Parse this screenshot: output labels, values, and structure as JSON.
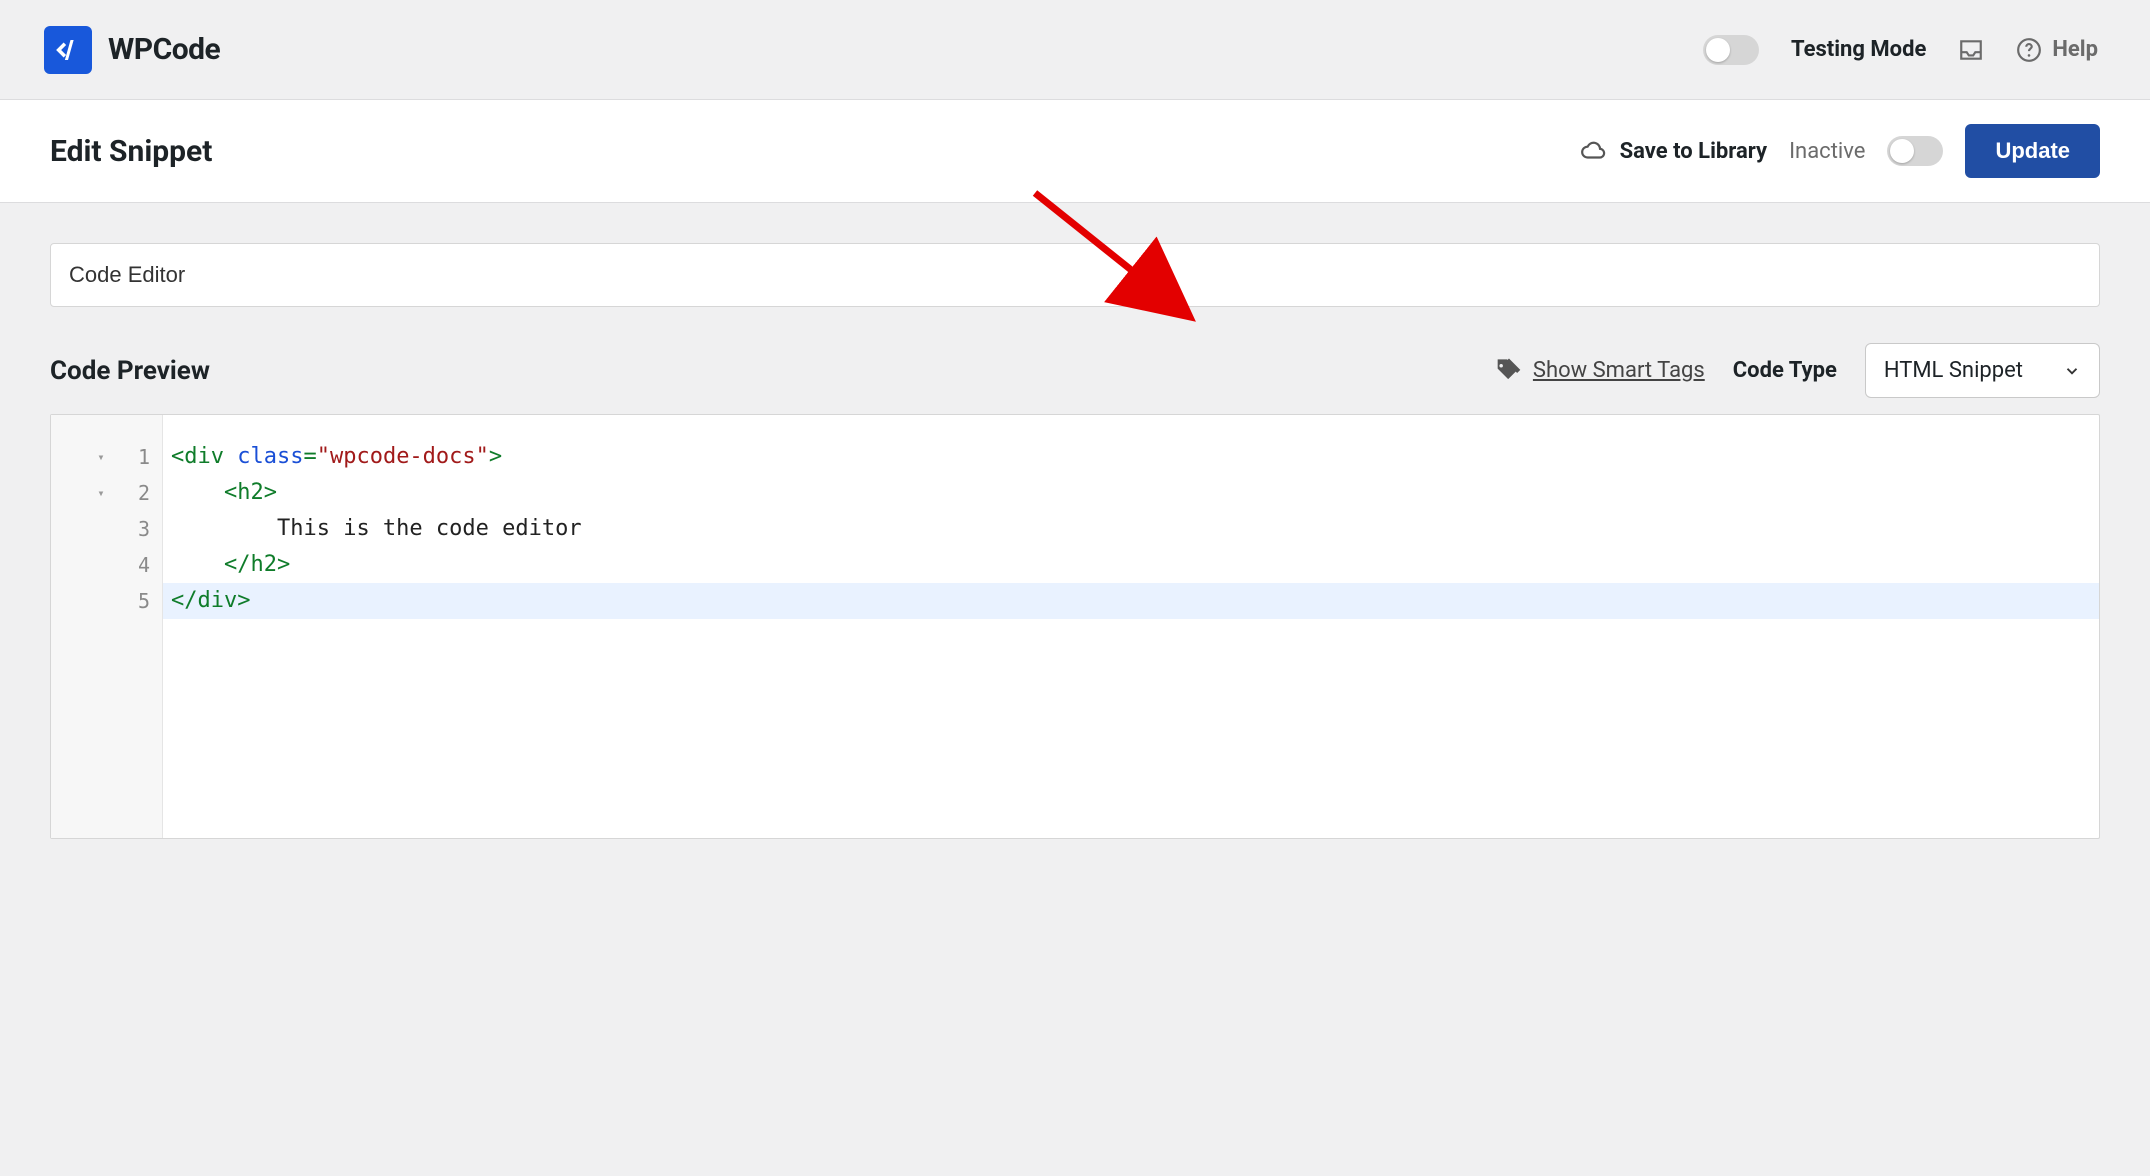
{
  "brand": {
    "name": "WPCode"
  },
  "topbar": {
    "testing_mode_label": "Testing Mode",
    "help_label": "Help"
  },
  "subheader": {
    "page_title": "Edit Snippet",
    "save_to_library": "Save to Library",
    "status_label": "Inactive",
    "update_button": "Update"
  },
  "main": {
    "snippet_title_value": "Code Editor",
    "code_preview_label": "Code Preview",
    "show_smart_tags": "Show Smart Tags",
    "code_type_label": "Code Type",
    "code_type_value": "HTML Snippet"
  },
  "editor": {
    "lines": [
      {
        "n": "1",
        "fold": "▾",
        "tokens": [
          {
            "t": "<div ",
            "c": "cm-tag"
          },
          {
            "t": "class",
            "c": "cm-attr"
          },
          {
            "t": "=",
            "c": "cm-punct"
          },
          {
            "t": "\"wpcode-docs\"",
            "c": "cm-string"
          },
          {
            "t": ">",
            "c": "cm-tag"
          }
        ]
      },
      {
        "n": "2",
        "fold": "▾",
        "indent": "    ",
        "tokens": [
          {
            "t": "<h2>",
            "c": "cm-tag"
          }
        ]
      },
      {
        "n": "3",
        "fold": "",
        "indent": "        ",
        "tokens": [
          {
            "t": "This is the code editor",
            "c": "cm-text"
          }
        ]
      },
      {
        "n": "4",
        "fold": "",
        "indent": "    ",
        "tokens": [
          {
            "t": "</h2>",
            "c": "cm-tag"
          }
        ]
      },
      {
        "n": "5",
        "fold": "",
        "tokens": [
          {
            "t": "</div>",
            "c": "cm-tag"
          }
        ],
        "active": true
      }
    ]
  }
}
